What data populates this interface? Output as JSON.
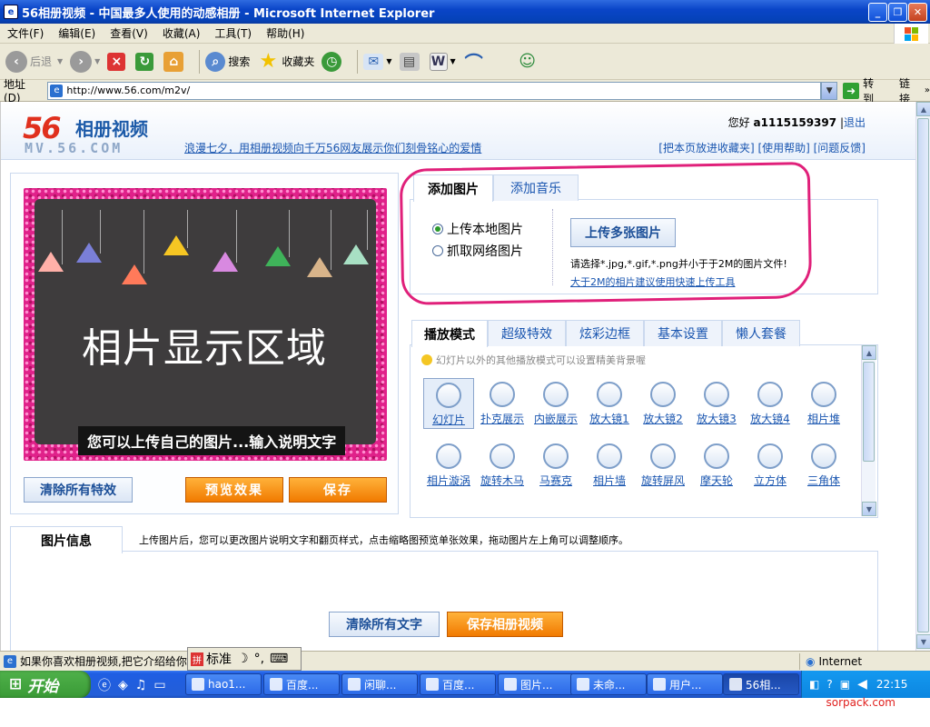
{
  "window": {
    "title": "56相册视频 - 中国最多人使用的动感相册 - Microsoft Internet Explorer"
  },
  "menu": [
    "文件(F)",
    "编辑(E)",
    "查看(V)",
    "收藏(A)",
    "工具(T)",
    "帮助(H)"
  ],
  "toolbar": {
    "back": "后退",
    "search": "搜索",
    "favorites": "收藏夹"
  },
  "address": {
    "label": "地址(D)",
    "url": "http://www.56.com/m2v/",
    "go": "转到",
    "links": "链接"
  },
  "site": {
    "logo_num": "56",
    "logo_text": "相册视频",
    "logo_domain": "MV.56.COM",
    "slogan": "浪漫七夕，用相册视频向千万56网友展示你们刻骨铭心的爱情",
    "greeting_prefix": "您好",
    "username": "a1115159397",
    "logout": "退出",
    "links": "[把本页放进收藏夹] [使用帮助] [问题反馈]"
  },
  "preview": {
    "area_label": "相片显示区域",
    "caption": "您可以上传自己的图片...输入说明文字",
    "clear_fx": "清除所有特效",
    "preview_btn": "预览效果",
    "save_btn": "保存"
  },
  "upload": {
    "tab_add_photo": "添加图片",
    "tab_add_music": "添加音乐",
    "radio_local": "上传本地图片",
    "radio_web": "抓取网络图片",
    "upload_multi": "上传多张图片",
    "hint": "请选择*.jpg,*.gif,*.png并小于于2M的图片文件!",
    "link": "大于2M的相片建议使用快速上传工具"
  },
  "effects": {
    "tabs": [
      "播放模式",
      "超级特效",
      "炫彩边框",
      "基本设置",
      "懒人套餐"
    ],
    "hint": "幻灯片以外的其他播放模式可以设置精美背景喔",
    "items": [
      "幻灯片",
      "扑克展示",
      "内嵌展示",
      "放大镜1",
      "放大镜2",
      "放大镜3",
      "放大镜4",
      "相片堆",
      "相片漩涡",
      "旋转木马",
      "马赛克",
      "相片墙",
      "旋转屏风",
      "摩天轮",
      "立方体",
      "三角体"
    ]
  },
  "info": {
    "tab": "图片信息",
    "desc": "上传图片后，您可以更改图片说明文字和翻页样式，点击缩略图预览单张效果，拖动图片左上角可以调整顺序。",
    "clear_text": "清除所有文字",
    "save_video": "保存相册视频"
  },
  "status": {
    "text": "如果你喜欢相册视频,把它介绍给你",
    "ime": "标准",
    "zone": "Internet"
  },
  "taskbar": {
    "start": "开始",
    "tasks": [
      "hao1...",
      "百度...",
      "闲聊...",
      "百度...",
      "图片...",
      "未命...",
      "用户...",
      "56相..."
    ],
    "clock": "22:15"
  },
  "watermark": "sorpack.com",
  "colors": {
    "accent_pink": "#e0207a",
    "orange": "#f17a00",
    "link_blue": "#1a56b0"
  }
}
